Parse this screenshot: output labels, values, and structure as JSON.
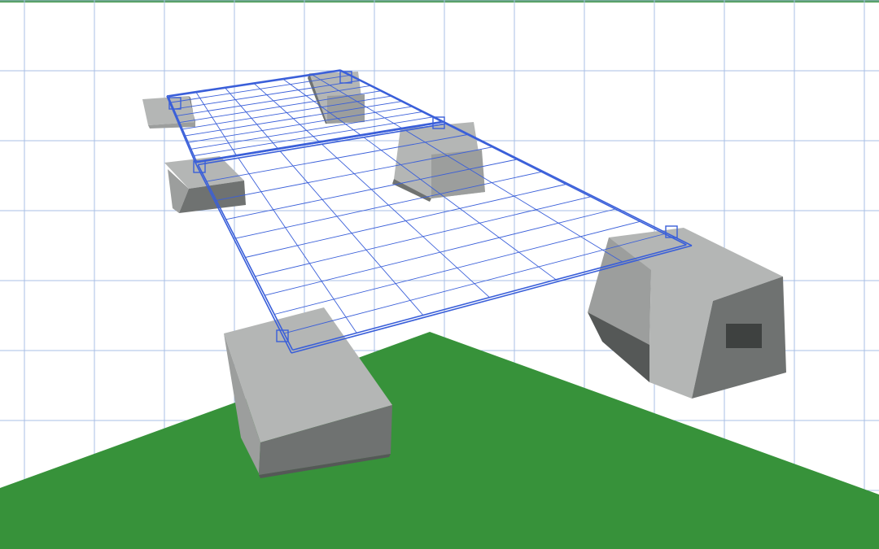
{
  "illustration": {
    "subject": "wireframe-solar-panels-on-concrete-ballast-blocks",
    "panel_count": 2,
    "block_count": 6
  },
  "colors": {
    "background": "#ffffff",
    "grid_line": "#a8bfe6",
    "ground": "#37923a",
    "top_bar": "#37923a",
    "wireframe": "#3a5fd9",
    "block_light": "#b4b6b5",
    "block_mid": "#9c9e9d",
    "block_dark": "#6f7271",
    "block_shadow": "#555857",
    "vent": "#3e4140"
  }
}
